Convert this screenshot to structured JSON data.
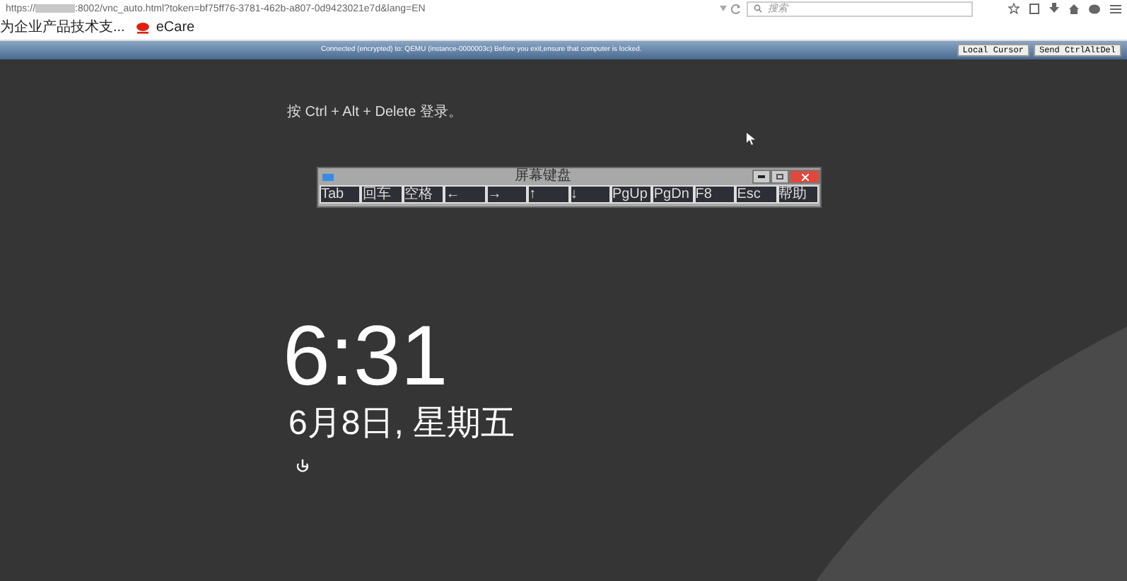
{
  "browser": {
    "url_scheme": "https://",
    "url_rest": ":8002/vnc_auto.html?token=bf75ff76-3781-462b-a807-0d9423021e7d&lang=EN",
    "search_placeholder": "搜索"
  },
  "bookmarks": [
    {
      "label": "为企业产品技术支...",
      "kind": "plain"
    },
    {
      "label": "eCare",
      "kind": "logo"
    }
  ],
  "vnc_bar": {
    "status": "Connected (encrypted) to: QEMU (instance-0000003c) Before you exit,ensure that computer is locked.",
    "buttons": [
      "Local Cursor",
      "Send CtrlAltDel"
    ]
  },
  "lock_screen": {
    "prompt": "按 Ctrl + Alt + Delete 登录。",
    "time": "6:31",
    "date": "6月8日, 星期五"
  },
  "keyboard": {
    "title": "屏幕键盘",
    "keys": [
      "Tab",
      "回车",
      "空格",
      "←",
      "→",
      "↑",
      "↓",
      "PgUp",
      "PgDn",
      "F8",
      "Esc",
      "帮助"
    ]
  }
}
